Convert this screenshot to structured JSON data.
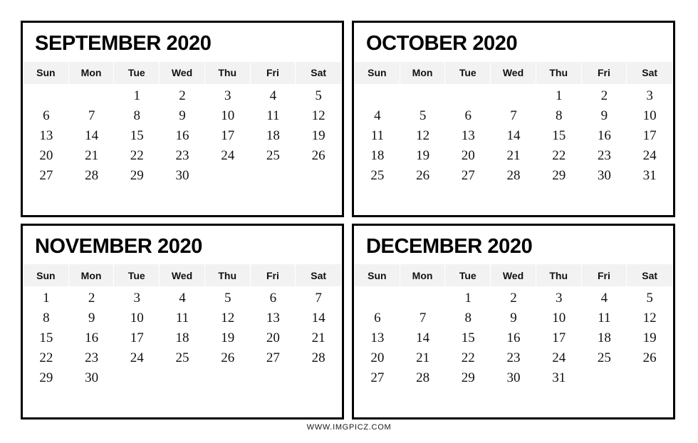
{
  "page": {
    "background_color": "#ffffff",
    "border_color": "#000000",
    "weekday_header_background": "#f2f2f2",
    "text_color": "#111111"
  },
  "footer": {
    "watermark": "WWW.IMGPICZ.COM"
  },
  "weekday_labels": [
    "Sun",
    "Mon",
    "Tue",
    "Wed",
    "Thu",
    "Fri",
    "Sat"
  ],
  "months": [
    {
      "title": "SEPTEMBER 2020",
      "name": "September",
      "year": "2020",
      "start_weekday_index": 2,
      "days_in_month": 30,
      "weeks": [
        [
          "",
          "",
          "1",
          "2",
          "3",
          "4",
          "5"
        ],
        [
          "6",
          "7",
          "8",
          "9",
          "10",
          "11",
          "12"
        ],
        [
          "13",
          "14",
          "15",
          "16",
          "17",
          "18",
          "19"
        ],
        [
          "20",
          "21",
          "22",
          "23",
          "24",
          "25",
          "26"
        ],
        [
          "27",
          "28",
          "29",
          "30",
          "",
          "",
          ""
        ]
      ]
    },
    {
      "title": "OCTOBER 2020",
      "name": "October",
      "year": "2020",
      "start_weekday_index": 4,
      "days_in_month": 31,
      "weeks": [
        [
          "",
          "",
          "",
          "",
          "1",
          "2",
          "3"
        ],
        [
          "4",
          "5",
          "6",
          "7",
          "8",
          "9",
          "10"
        ],
        [
          "11",
          "12",
          "13",
          "14",
          "15",
          "16",
          "17"
        ],
        [
          "18",
          "19",
          "20",
          "21",
          "22",
          "23",
          "24"
        ],
        [
          "25",
          "26",
          "27",
          "28",
          "29",
          "30",
          "31"
        ]
      ]
    },
    {
      "title": "NOVEMBER 2020",
      "name": "November",
      "year": "2020",
      "start_weekday_index": 0,
      "days_in_month": 30,
      "weeks": [
        [
          "1",
          "2",
          "3",
          "4",
          "5",
          "6",
          "7"
        ],
        [
          "8",
          "9",
          "10",
          "11",
          "12",
          "13",
          "14"
        ],
        [
          "15",
          "16",
          "17",
          "18",
          "19",
          "20",
          "21"
        ],
        [
          "22",
          "23",
          "24",
          "25",
          "26",
          "27",
          "28"
        ],
        [
          "29",
          "30",
          "",
          "",
          "",
          "",
          ""
        ]
      ]
    },
    {
      "title": "DECEMBER 2020",
      "name": "December",
      "year": "2020",
      "start_weekday_index": 2,
      "days_in_month": 31,
      "weeks": [
        [
          "",
          "",
          "1",
          "2",
          "3",
          "4",
          "5"
        ],
        [
          "6",
          "7",
          "8",
          "9",
          "10",
          "11",
          "12"
        ],
        [
          "13",
          "14",
          "15",
          "16",
          "17",
          "18",
          "19"
        ],
        [
          "20",
          "21",
          "22",
          "23",
          "24",
          "25",
          "26"
        ],
        [
          "27",
          "28",
          "29",
          "30",
          "31",
          "",
          ""
        ]
      ]
    }
  ]
}
